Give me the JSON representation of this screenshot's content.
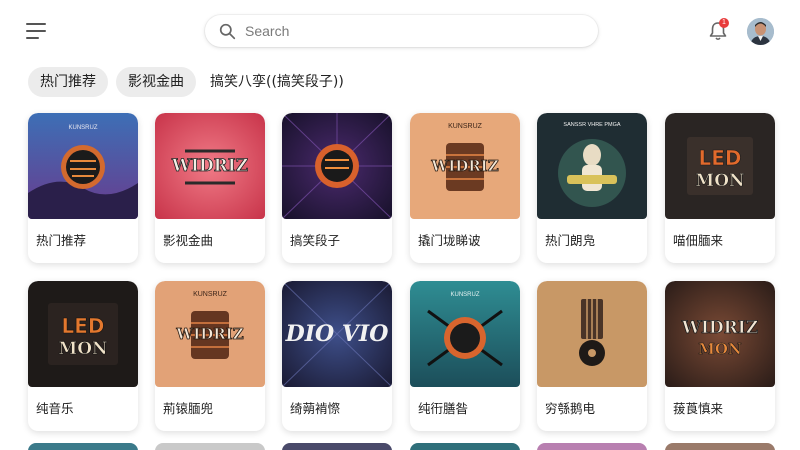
{
  "search": {
    "placeholder": "Search",
    "icon": "search-icon"
  },
  "header": {
    "notification_count": "1"
  },
  "chips": [
    {
      "label": "热门推荐"
    },
    {
      "label": "影视金曲"
    },
    {
      "label": "搞笑八孪((搞笑段子))"
    }
  ],
  "albums": [
    {
      "title": "热门推荐"
    },
    {
      "title": "影视金曲"
    },
    {
      "title": "搞笑段子"
    },
    {
      "title": "撬门垅睇诐"
    },
    {
      "title": "热门朗凫"
    },
    {
      "title": "喵佃腼来"
    },
    {
      "title": "纯音乐"
    },
    {
      "title": "荊锿腼兜"
    },
    {
      "title": "绮蒴褃憏"
    },
    {
      "title": "纯衎膳昝"
    },
    {
      "title": "穷綔鹅电"
    },
    {
      "title": "菝莨慎来"
    }
  ],
  "cover_texts": {
    "wioriz": "WIDRIZ",
    "ledmon": "LED",
    "ledmon2": "MON",
    "diovio": "DIO VIO",
    "kunsruz": "KUNSRUZ",
    "sanssr": "SANSSR VHRE PMGA"
  },
  "colors": {
    "accent": "#e83b3b",
    "chip_bg": "#ececec"
  }
}
